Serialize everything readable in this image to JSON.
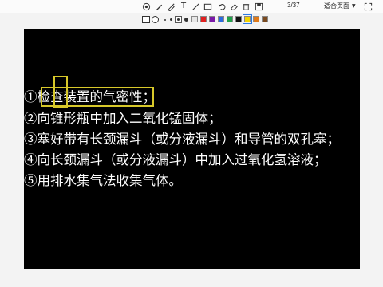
{
  "toolbar": {
    "tools": [
      {
        "name": "pointer",
        "icon": "pointer-icon"
      },
      {
        "name": "pen",
        "icon": "pen-icon"
      },
      {
        "name": "highlighter",
        "icon": "highlighter-icon"
      },
      {
        "name": "text",
        "icon": "text-icon",
        "glyph": "T"
      },
      {
        "name": "line",
        "icon": "line-icon"
      },
      {
        "name": "rectangle",
        "icon": "rectangle-icon"
      },
      {
        "name": "undo",
        "icon": "undo-icon"
      },
      {
        "name": "eraser",
        "icon": "eraser-icon"
      },
      {
        "name": "clear",
        "icon": "clear-icon"
      },
      {
        "name": "save",
        "icon": "save-icon"
      }
    ],
    "page_indicator": "3/37",
    "fit_label": "适合页面",
    "fullscreen_icon": "fullscreen-icon"
  },
  "style_picker": {
    "colors": [
      "#e6e6e6",
      "#e02020",
      "#7a1aa8",
      "#2b6be0",
      "#21a34a",
      "#111111",
      "#f3d400",
      "#e07a1a",
      "#7a4a20"
    ],
    "selected_color": "#f3d400"
  },
  "slide": {
    "lines": [
      "①检查装置的气密性；",
      "②向锥形瓶中加入二氧化锰固体；",
      "③塞好带有长颈漏斗（或分液漏斗）和导管的双孔塞；",
      "④向长颈漏斗（或分液漏斗）中加入过氧化氢溶液；",
      "⑤用排水集气法收集气体。"
    ],
    "annotation_color": "#d7c82a"
  }
}
